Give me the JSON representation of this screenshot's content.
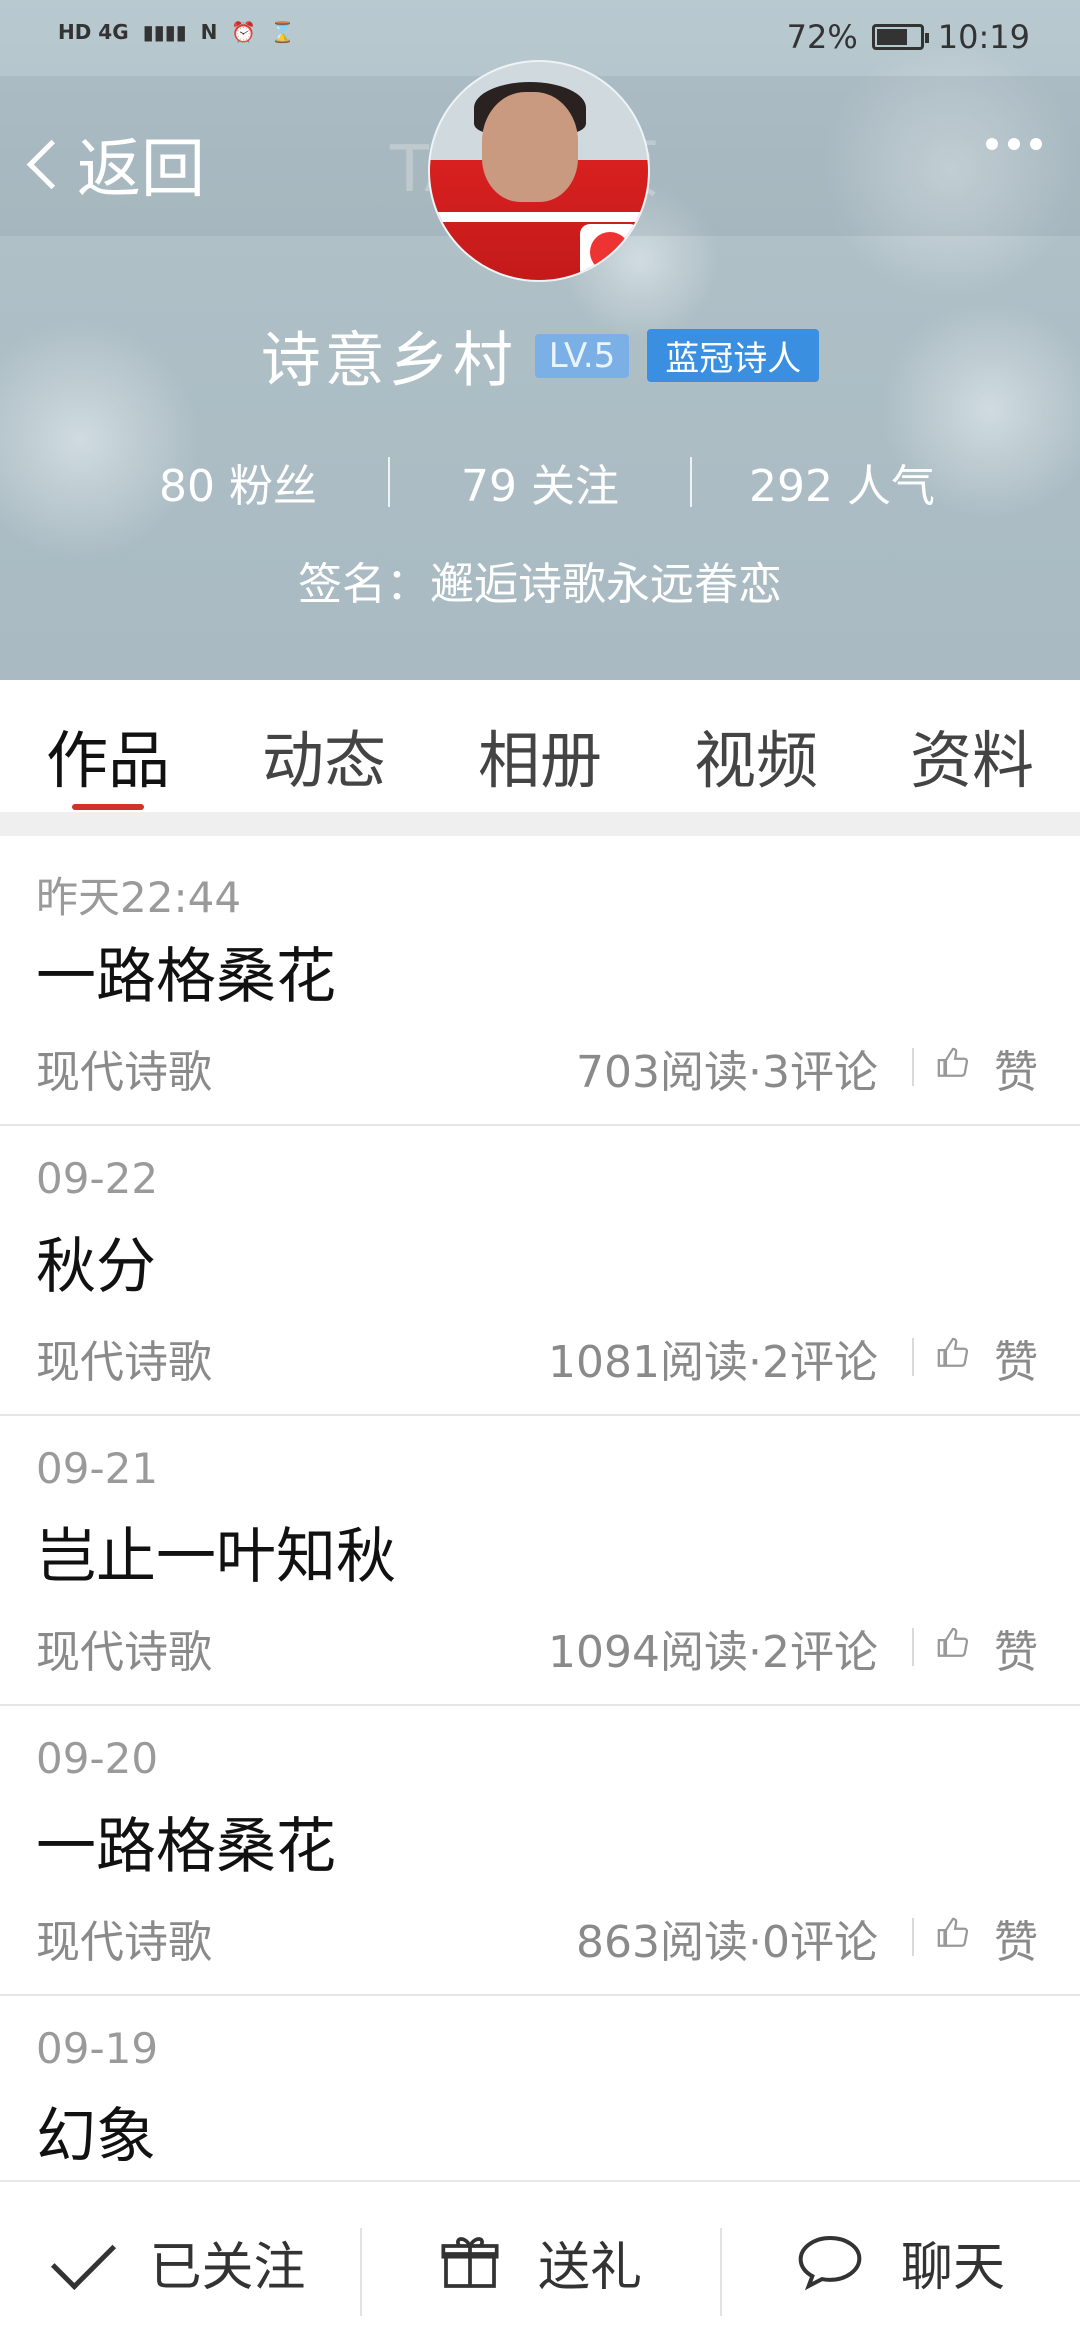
{
  "status_bar": {
    "left_text": "HD 4G",
    "battery": "72%",
    "battery_level": 0.72,
    "time": "10:19"
  },
  "header": {
    "back_label": "返回",
    "ghost_title": "TA的主页",
    "name": "诗意乡村",
    "level_badge": "LV.5",
    "title_badge": "蓝冠诗人",
    "stats": [
      {
        "value": "80",
        "label": "粉丝"
      },
      {
        "value": "79",
        "label": "关注"
      },
      {
        "value": "292",
        "label": "人气"
      }
    ],
    "signature": "签名：邂逅诗歌永远眷恋"
  },
  "tabs": [
    {
      "label": "作品",
      "active": true
    },
    {
      "label": "动态",
      "active": false
    },
    {
      "label": "相册",
      "active": false
    },
    {
      "label": "视频",
      "active": false
    },
    {
      "label": "资料",
      "active": false
    }
  ],
  "works": [
    {
      "date": "昨天22:44",
      "title": "一路格桑花",
      "category": "现代诗歌",
      "stats": "703阅读·3评论",
      "like": "赞"
    },
    {
      "date": "09-22",
      "title": "秋分",
      "category": "现代诗歌",
      "stats": "1081阅读·2评论",
      "like": "赞"
    },
    {
      "date": "09-21",
      "title": "岂止一叶知秋",
      "category": "现代诗歌",
      "stats": "1094阅读·2评论",
      "like": "赞"
    },
    {
      "date": "09-20",
      "title": "一路格桑花",
      "category": "现代诗歌",
      "stats": "863阅读·0评论",
      "like": "赞"
    },
    {
      "date": "09-19",
      "title": "幻象",
      "category": "",
      "stats": "",
      "like": ""
    }
  ],
  "bottom_bar": {
    "follow": "已关注",
    "gift": "送礼",
    "chat": "聊天"
  },
  "colors": {
    "accent": "#d0332b",
    "level_badge": "#7ab0e6",
    "title_badge": "#3a8fe0"
  }
}
